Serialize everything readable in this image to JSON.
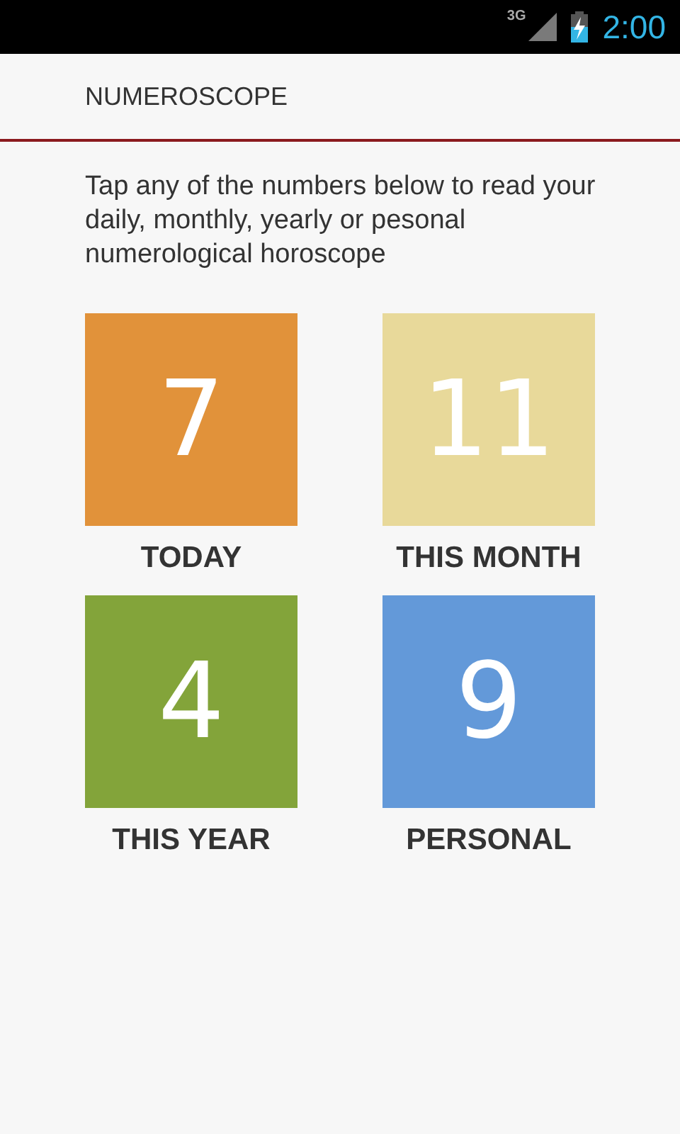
{
  "status_bar": {
    "network": "3G",
    "time": "2:00"
  },
  "app_bar": {
    "title": "NUMEROSCOPE"
  },
  "intro": "Tap any of the numbers below to read your daily, monthly, yearly or pesonal numerological horoscope",
  "tiles": [
    {
      "number": "7",
      "label": "TODAY",
      "color": "#e1923a"
    },
    {
      "number": "11",
      "label": "THIS MONTH",
      "color": "#e8d99a"
    },
    {
      "number": "4",
      "label": "THIS YEAR",
      "color": "#83a43a"
    },
    {
      "number": "9",
      "label": "PERSONAL",
      "color": "#6399d9"
    }
  ]
}
